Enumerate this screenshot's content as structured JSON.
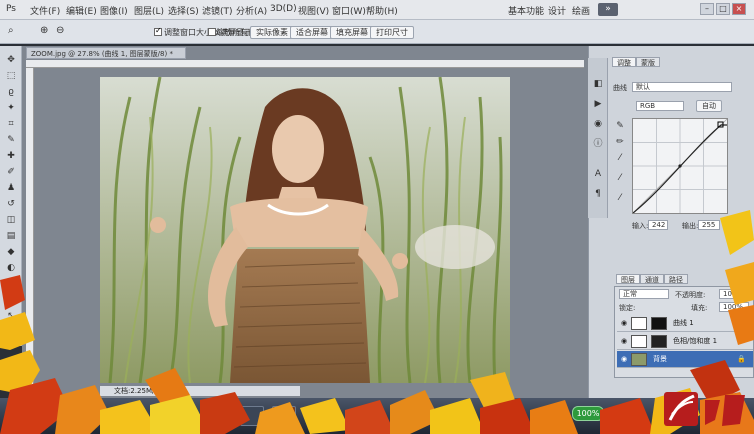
{
  "menubar": {
    "items": [
      "文件(F)",
      "编辑(E)",
      "图像(I)",
      "图层(L)",
      "选择(S)",
      "滤镜(T)",
      "分析(A)",
      "3D(D)",
      "视图(V)",
      "窗口(W)",
      "帮助(H)"
    ],
    "workspaces": [
      "基本功能",
      "设计",
      "绘画"
    ],
    "active_workspace": "»"
  },
  "options": {
    "zoom_checkbox": "调整窗口大小以满屏显示",
    "all_windows_checkbox": "缩放所有窗口",
    "buttons": [
      "实际像素",
      "适合屏幕",
      "填充屏幕",
      "打印尺寸"
    ]
  },
  "document": {
    "tab": "ZOOM.jpg @ 27.8% (曲线 1, 图层蒙版/8) *",
    "status": "文档:2.25M/4.50M"
  },
  "adjustments": {
    "tabs": [
      "调整",
      "蒙版"
    ],
    "active_tab": "调整",
    "preset_label": "曲线",
    "preset_value": "默认",
    "channel_value": "RGB",
    "auto_button": "自动",
    "input_label": "输入:",
    "input_value": "242",
    "output_label": "输出:",
    "output_value": "255"
  },
  "layers": {
    "tabs": [
      "图层",
      "通道",
      "路径"
    ],
    "blend_mode": "正常",
    "opacity_label": "不透明度:",
    "opacity_value": "100%",
    "lock_label": "锁定:",
    "fill_label": "填充:",
    "fill_value": "100%",
    "rows": [
      {
        "name": "曲线 1",
        "selected": false
      },
      {
        "name": "色相/饱和度 1",
        "selected": false
      },
      {
        "name": "背景",
        "selected": true
      }
    ]
  },
  "taskbar": {
    "zoom_badge": "100%"
  }
}
